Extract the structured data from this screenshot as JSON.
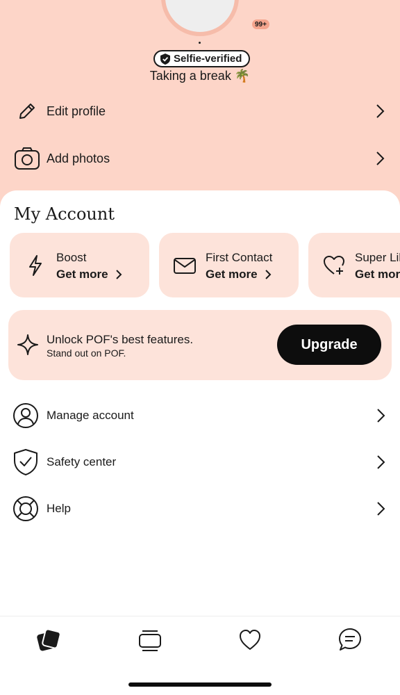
{
  "profile": {
    "verified_badge": "Selfie-verified",
    "status": "Taking a break 🌴",
    "actions": [
      {
        "label": "Edit profile",
        "icon": "pencil-icon"
      },
      {
        "label": "Add photos",
        "icon": "camera-icon"
      }
    ]
  },
  "account": {
    "title": "My Account",
    "cards": [
      {
        "title": "Boost",
        "action": "Get more",
        "icon": "lightning-icon"
      },
      {
        "title": "First Contact",
        "action": "Get more",
        "icon": "envelope-icon"
      },
      {
        "title": "Super Likes",
        "action": "Get more",
        "icon": "heart-plus-icon"
      }
    ],
    "upgrade": {
      "headline": "Unlock POF's best features.",
      "subline": "Stand out on POF.",
      "button": "Upgrade"
    },
    "menu": [
      {
        "label": "Manage account",
        "icon": "user-circle-icon"
      },
      {
        "label": "Safety center",
        "icon": "shield-check-icon"
      },
      {
        "label": "Help",
        "icon": "lifebuoy-icon"
      }
    ]
  },
  "tabbar": {
    "tabs": [
      "cards-icon",
      "stack-icon",
      "heart-icon",
      "chat-icon"
    ],
    "likes_badge": "99+"
  },
  "colors": {
    "header_bg": "#fdd5c8",
    "card_bg": "#fde3da",
    "button_bg": "#0d0d0d",
    "badge_bg": "#f4a48d"
  }
}
